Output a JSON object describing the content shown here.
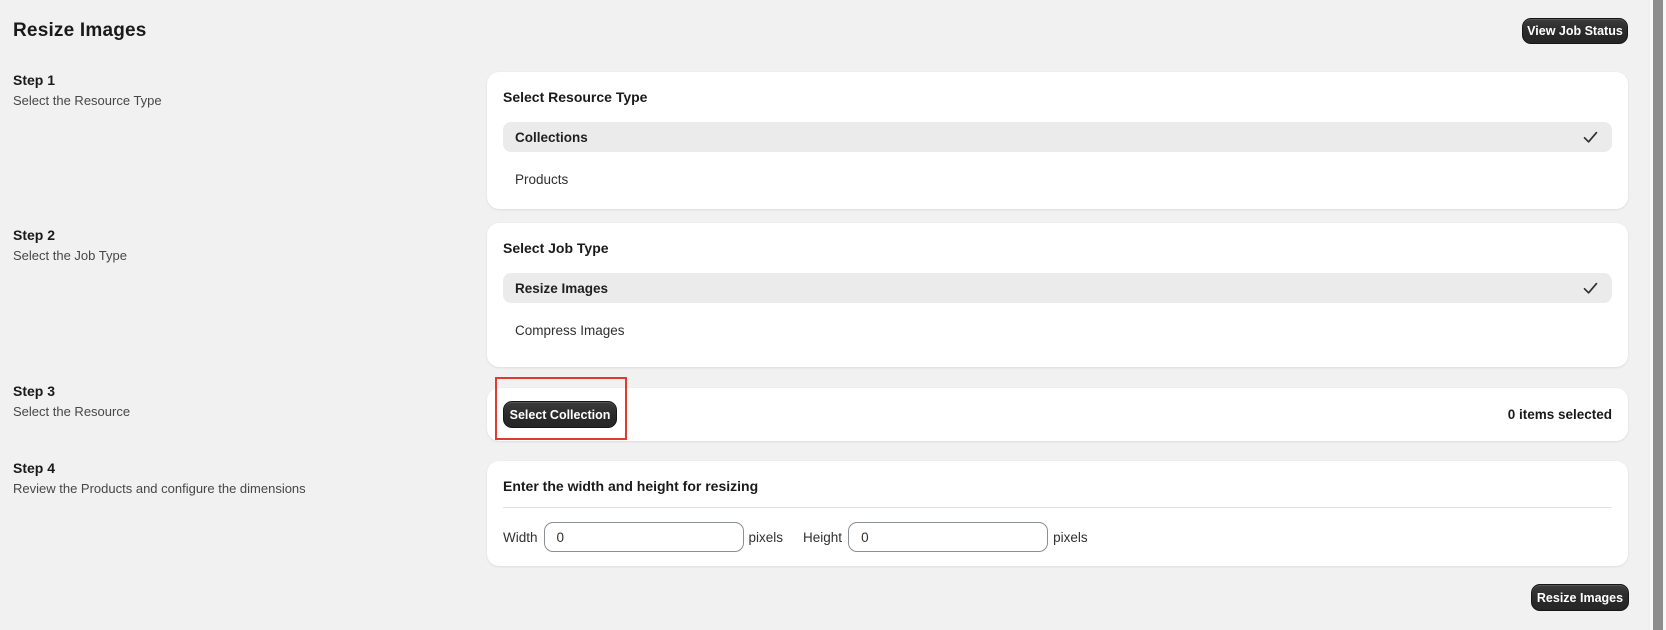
{
  "page": {
    "title": "Resize Images"
  },
  "header": {
    "view_job_status_label": "View Job Status"
  },
  "steps": [
    {
      "title": "Step 1",
      "description": "Select the Resource Type"
    },
    {
      "title": "Step 2",
      "description": "Select the Job Type"
    },
    {
      "title": "Step 3",
      "description": "Select the Resource"
    },
    {
      "title": "Step 4",
      "description": "Review the Products and configure the dimensions"
    }
  ],
  "resource_type_card": {
    "title": "Select Resource Type",
    "options": [
      {
        "label": "Collections",
        "selected": true
      },
      {
        "label": "Products",
        "selected": false
      }
    ]
  },
  "job_type_card": {
    "title": "Select Job Type",
    "options": [
      {
        "label": "Resize Images",
        "selected": true
      },
      {
        "label": "Compress Images",
        "selected": false
      }
    ]
  },
  "resource_card": {
    "select_button_label": "Select Collection",
    "selection_status": "0 items selected"
  },
  "dimensions_card": {
    "title": "Enter the width and height for resizing",
    "width_label": "Width",
    "width_value": "0",
    "width_unit": "pixels",
    "height_label": "Height",
    "height_value": "0",
    "height_unit": "pixels"
  },
  "footer": {
    "resize_button_label": "Resize Images"
  },
  "colors": {
    "page_bg": "#f1f1f1",
    "card_bg": "#ffffff",
    "selected_row_bg": "#ebebeb",
    "dark_button_bg": "#2b2b2b",
    "highlight_box_red": "#e23a2e"
  }
}
